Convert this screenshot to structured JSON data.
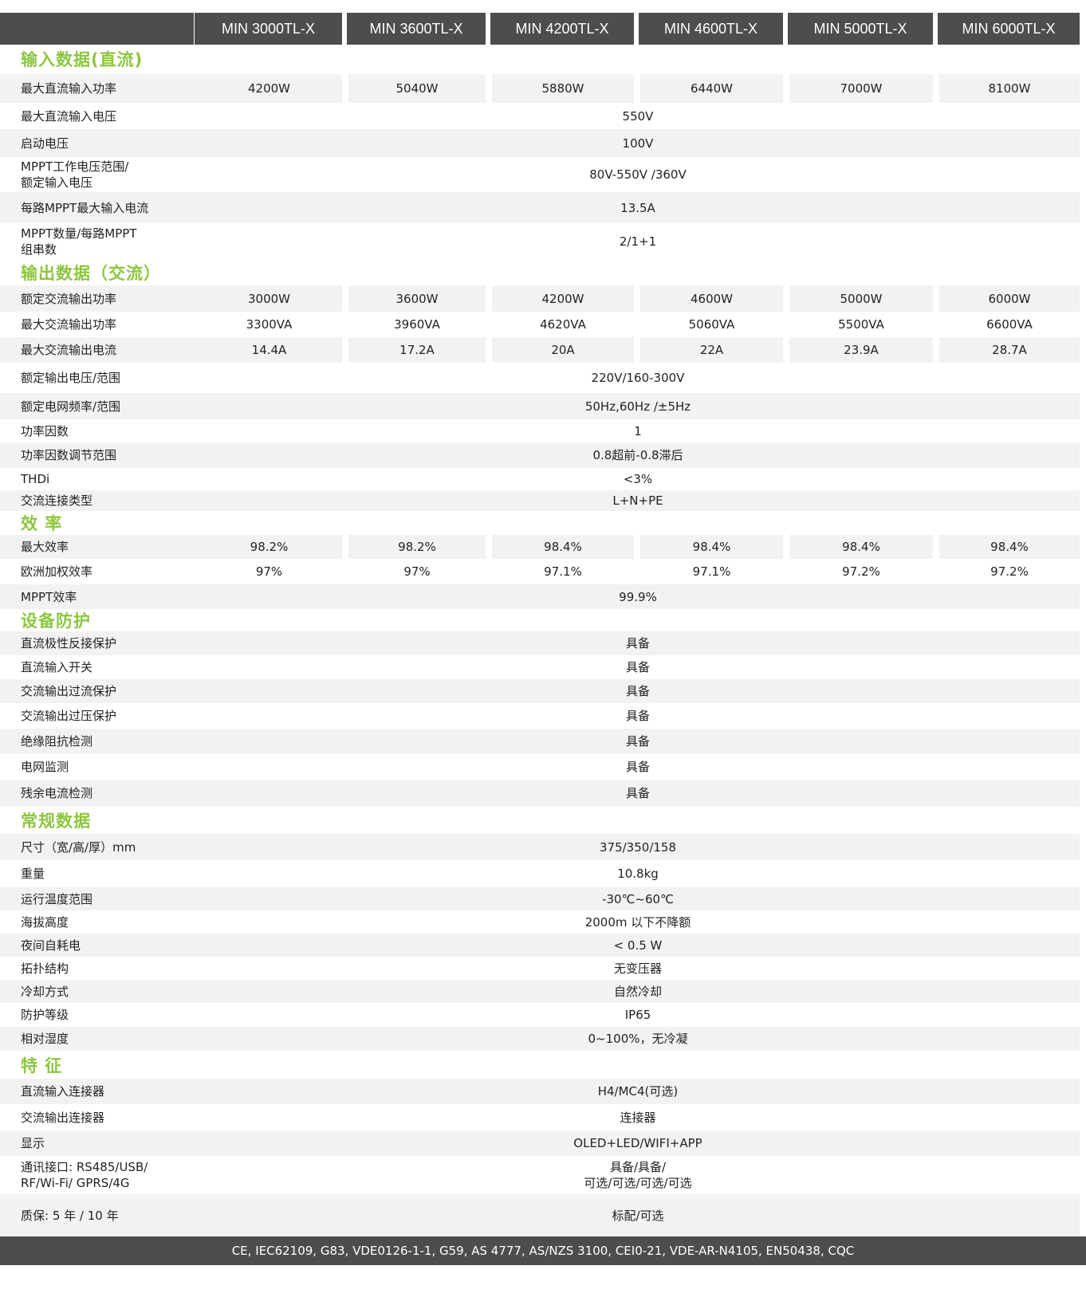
{
  "header": {
    "models": [
      "MIN 3000TL-X",
      "MIN 3600TL-X",
      "MIN 4200TL-X",
      "MIN 4600TL-X",
      "MIN 5000TL-X",
      "MIN 6000TL-X"
    ]
  },
  "sections": [
    {
      "title": "输入数据(直流)",
      "rows": [
        {
          "label": "最大直流输入功率",
          "values": [
            "4200W",
            "5040W",
            "5880W",
            "6440W",
            "7000W",
            "8100W"
          ]
        },
        {
          "label": "最大直流输入电压",
          "values": [
            "550V"
          ]
        },
        {
          "label": "启动电压",
          "values": [
            "100V"
          ]
        },
        {
          "label": "MPPT工作电压范围/\n额定输入电压",
          "values": [
            "80V-550V /360V"
          ]
        },
        {
          "label": "每路MPPT最大输入电流",
          "values": [
            "13.5A"
          ]
        },
        {
          "label": "MPPT数量/每路MPPT\n组串数",
          "values": [
            "2/1+1"
          ]
        }
      ]
    },
    {
      "title": "输出数据（交流）",
      "rows": [
        {
          "label": "额定交流输出功率",
          "values": [
            "3000W",
            "3600W",
            "4200W",
            "4600W",
            "5000W",
            "6000W"
          ]
        },
        {
          "label": "最大交流输出功率",
          "values": [
            "3300VA",
            "3960VA",
            "4620VA",
            "5060VA",
            "5500VA",
            "6600VA"
          ]
        },
        {
          "label": "最大交流输出电流",
          "values": [
            "14.4A",
            "17.2A",
            "20A",
            "22A",
            "23.9A",
            "28.7A"
          ]
        },
        {
          "label": "额定输出电压/范围",
          "values": [
            "220V/160-300V"
          ]
        },
        {
          "label": "额定电网频率/范围",
          "values": [
            "50Hz,60Hz /±5Hz"
          ]
        },
        {
          "label": "功率因数",
          "values": [
            "1"
          ]
        },
        {
          "label": "功率因数调节范围",
          "values": [
            "0.8超前-0.8滞后"
          ]
        },
        {
          "label": "THDi",
          "values": [
            "<3%"
          ]
        },
        {
          "label": "交流连接类型",
          "values": [
            "L+N+PE"
          ]
        }
      ]
    },
    {
      "title": "效  率",
      "rows": [
        {
          "label": "最大效率",
          "values": [
            "98.2%",
            "98.2%",
            "98.4%",
            "98.4%",
            "98.4%",
            "98.4%"
          ]
        },
        {
          "label": "欧洲加权效率",
          "values": [
            "97%",
            "97%",
            "97.1%",
            "97.1%",
            "97.2%",
            "97.2%"
          ]
        },
        {
          "label": "MPPT效率",
          "values": [
            "99.9%"
          ]
        }
      ]
    },
    {
      "title": "设备防护",
      "rows": [
        {
          "label": "直流极性反接保护",
          "values": [
            "具备"
          ]
        },
        {
          "label": "直流输入开关",
          "values": [
            "具备"
          ]
        },
        {
          "label": "交流输出过流保护",
          "values": [
            "具备"
          ]
        },
        {
          "label": "交流输出过压保护",
          "values": [
            "具备"
          ]
        },
        {
          "label": "绝缘阻抗检测",
          "values": [
            "具备"
          ]
        },
        {
          "label": "电网监测",
          "values": [
            "具备"
          ]
        },
        {
          "label": "残余电流检测",
          "values": [
            "具备"
          ]
        }
      ]
    },
    {
      "title": "常规数据",
      "rows": [
        {
          "label": "尺寸（宽/高/厚）mm",
          "values": [
            "375/350/158"
          ]
        },
        {
          "label": "重量",
          "values": [
            "10.8kg"
          ]
        },
        {
          "label": "运行温度范围",
          "values": [
            "-30℃~60℃"
          ]
        },
        {
          "label": "海拔高度",
          "values": [
            "2000m 以下不降额"
          ]
        },
        {
          "label": "夜间自耗电",
          "values": [
            "< 0.5 W"
          ]
        },
        {
          "label": "拓扑结构",
          "values": [
            "无变压器"
          ]
        },
        {
          "label": "冷却方式",
          "values": [
            "自然冷却"
          ]
        },
        {
          "label": "防护等级",
          "values": [
            "IP65"
          ]
        },
        {
          "label": "相对湿度",
          "values": [
            "0~100%，无冷凝"
          ]
        }
      ]
    },
    {
      "title": "特  征",
      "rows": [
        {
          "label": "直流输入连接器",
          "values": [
            "H4/MC4(可选)"
          ]
        },
        {
          "label": "交流输出连接器",
          "values": [
            "连接器"
          ]
        },
        {
          "label": "显示",
          "values": [
            "OLED+LED/WIFI+APP"
          ]
        },
        {
          "label": "通讯接口: RS485/USB/\nRF/Wi-Fi/ GPRS/4G",
          "values": [
            "具备/具备/\n可选/可选/可选/可选"
          ]
        },
        {
          "label": "质保: 5 年 / 10 年",
          "values": [
            "标配/可选"
          ]
        }
      ]
    }
  ],
  "footer": {
    "certifications": "CE, IEC62109, G83, VDE0126-1-1, G59, AS 4777, AS/NZS 3100, CEI0-21, VDE-AR-N4105, EN50438, CQC"
  }
}
